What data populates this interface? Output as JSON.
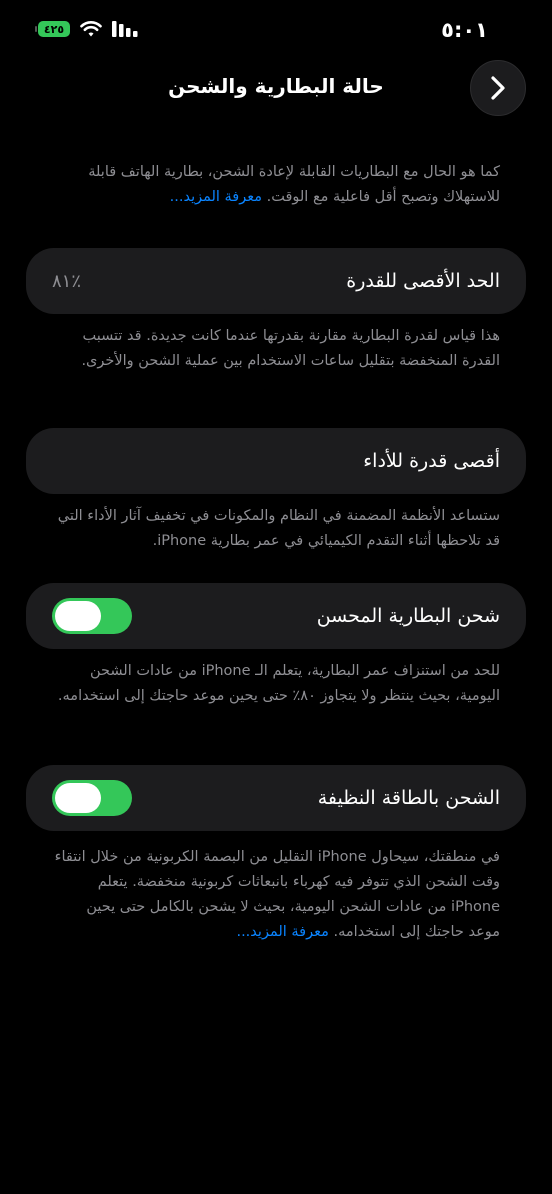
{
  "status_bar": {
    "time": "٥:٠١",
    "battery": "٤٢٥"
  },
  "nav": {
    "title": "حالة البطارية والشحن"
  },
  "intro": {
    "text": "كما هو الحال مع البطاريات القابلة لإعادة الشحن، بطارية الهاتف قابلة للاستهلاك وتصبح أقل فاعلية مع الوقت.",
    "link": "معرفة المزيد..."
  },
  "max_capacity": {
    "label": "الحد الأقصى للقدرة",
    "value": "٪٨١",
    "description": "هذا قياس لقدرة البطارية مقارنة بقدرتها عندما كانت جديدة. قد تتسبب القدرة المنخفضة بتقليل ساعات الاستخدام بين عملية الشحن والأخرى."
  },
  "peak_performance": {
    "label": "أقصى قدرة للأداء",
    "description": "ستساعد الأنظمة المضمنة في النظام والمكونات في تخفيف آثار الأداء التي قد تلاحظها أثناء التقدم الكيميائي في عمر بطارية iPhone."
  },
  "optimized_charging": {
    "label": "شحن البطارية المحسن",
    "enabled": true,
    "description": "للحد من استنزاف عمر البطارية، يتعلم الـ iPhone من عادات الشحن اليومية، بحيث ينتظر ولا يتجاوز ٨٠٪ حتى يحين موعد حاجتك إلى استخدامه."
  },
  "clean_energy": {
    "label": "الشحن بالطاقة النظيفة",
    "enabled": true,
    "description": "في منطقتك، سيحاول iPhone التقليل من البصمة الكربونية من خلال انتقاء وقت الشحن الذي تتوفر فيه كهرباء بانبعاثات كربونية منخفضة. يتعلم iPhone من عادات الشحن اليومية، بحيث لا يشحن بالكامل حتى يحين موعد حاجتك إلى استخدامه.",
    "link": "معرفة المزيد..."
  },
  "colors": {
    "background": "#000000",
    "card": "#1c1c1e",
    "toggle_on": "#34c759",
    "link": "#0a84ff",
    "secondary_text": "#8e8e93"
  }
}
